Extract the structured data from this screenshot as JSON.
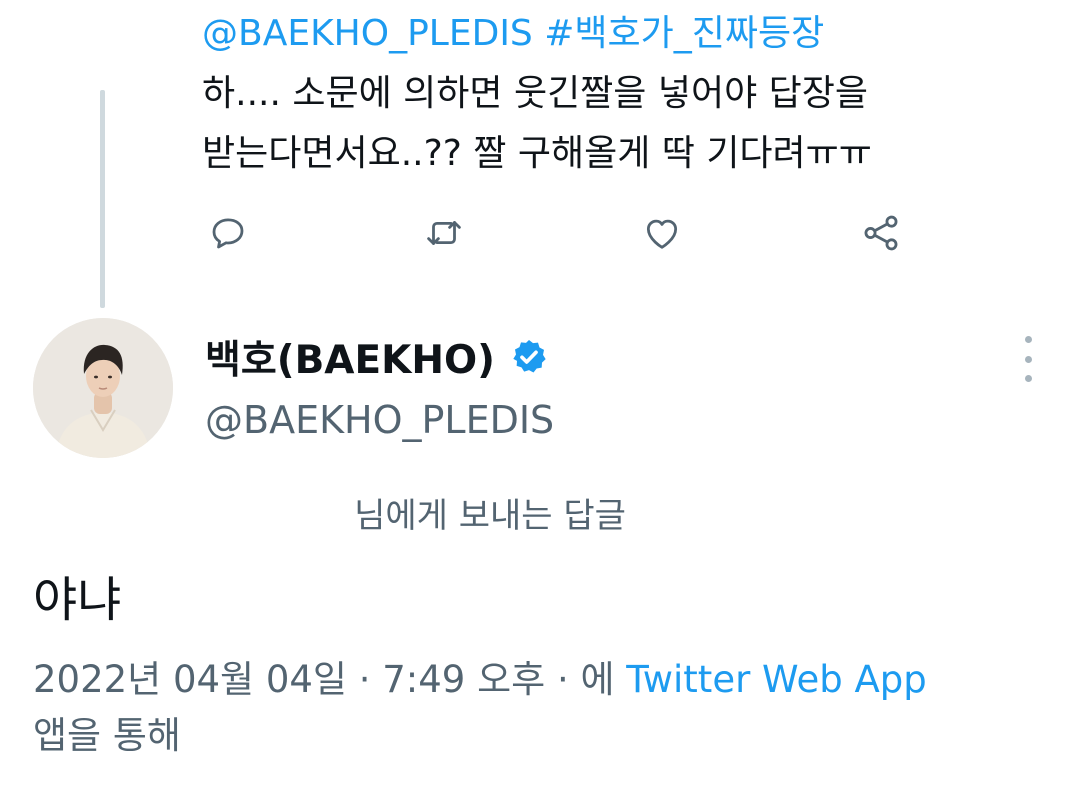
{
  "parent_tweet": {
    "mention": "@BAEKHO_PLEDIS",
    "hashtag": "#백호가_진짜등장",
    "line2": "하.... 소문에 의하면 웃긴짤을 넣어야 답장을",
    "line3": "받는다면서요..?? 짤 구해올게 딱 기다려ㅠㅠ",
    "actions": {
      "reply_icon": "reply-icon",
      "retweet_icon": "retweet-icon",
      "like_icon": "heart-icon",
      "share_icon": "share-icon"
    }
  },
  "reply_tweet": {
    "author_name": "백호(BAEKHO)",
    "author_handle": "@BAEKHO_PLEDIS",
    "verified_icon": "verified-badge-icon",
    "replying_to": "님에게 보내는 답글",
    "body": "야냐",
    "timestamp": "2022년 04월 04일 · 7:49 오후 · 에",
    "source_app": "Twitter Web App",
    "source_suffix": "앱을 통해"
  },
  "colors": {
    "link": "#1d9bf0",
    "text": "#0f1419",
    "muted": "#536471",
    "thread_line": "#cfd9de",
    "verified": "#1d9bf0"
  }
}
